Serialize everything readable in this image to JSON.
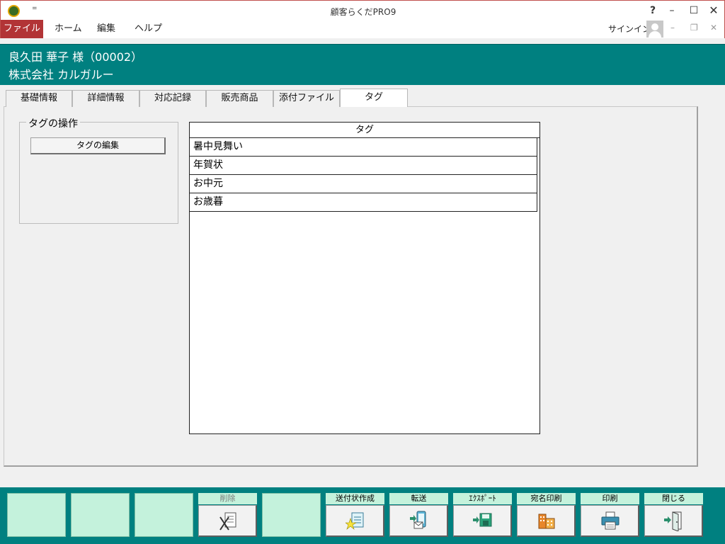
{
  "window": {
    "title": "顧客らくだPRO9",
    "qa_glyph": "=",
    "help_glyph": "?",
    "minimize_glyph": "–",
    "maximize_glyph": "☐",
    "close_glyph": "✕"
  },
  "menu": {
    "file": "ファイル",
    "home": "ホーム",
    "edit": "編集",
    "help": "ヘルプ",
    "signin": "サインイン",
    "mini_min": "–",
    "mini_restore": "❐",
    "mini_close": "✕"
  },
  "customer": {
    "name_line": "良久田 華子 様（00002）",
    "company": "株式会社 カルガルー"
  },
  "tabs": [
    {
      "label": "基礎情報"
    },
    {
      "label": "詳細情報"
    },
    {
      "label": "対応記録"
    },
    {
      "label": "販売商品"
    },
    {
      "label": "添付ファイル"
    },
    {
      "label": "タグ"
    }
  ],
  "active_tab": "タグ",
  "tag_ops": {
    "group_label": "タグの操作",
    "edit_button": "タグの編集"
  },
  "tag_list": {
    "header": "タグ",
    "rows": [
      "暑中見舞い",
      "年賀状",
      "お中元",
      "お歳暮"
    ]
  },
  "footer": {
    "buttons": [
      {
        "label": "",
        "icon": "",
        "enabled": false
      },
      {
        "label": "",
        "icon": "",
        "enabled": false
      },
      {
        "label": "",
        "icon": "",
        "enabled": false
      },
      {
        "label": "削除",
        "icon": "delete-icon",
        "enabled": false
      },
      {
        "label": "",
        "icon": "",
        "enabled": false
      },
      {
        "label": "送付状作成",
        "icon": "cover-letter-icon",
        "enabled": true
      },
      {
        "label": "転送",
        "icon": "transfer-icon",
        "enabled": true
      },
      {
        "label": "ｴｸｽﾎﾟｰﾄ",
        "icon": "export-icon",
        "enabled": true
      },
      {
        "label": "宛名印刷",
        "icon": "address-print-icon",
        "enabled": true
      },
      {
        "label": "印刷",
        "icon": "printer-icon",
        "enabled": true
      },
      {
        "label": "閉じる",
        "icon": "exit-door-icon",
        "enabled": true
      }
    ]
  },
  "colors": {
    "accent_teal": "#008080",
    "file_menu_red": "#b23436",
    "footer_button_mint": "#c4f2dc"
  }
}
